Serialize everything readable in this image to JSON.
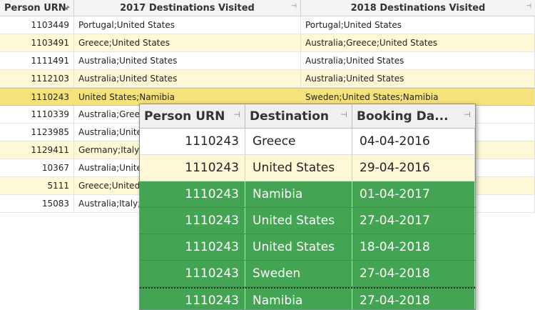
{
  "main_grid": {
    "columns": [
      "Person URN",
      "2017 Destinations Visited",
      "2018 Destinations Visited"
    ],
    "rows": [
      {
        "urn": "1103449",
        "d2017": "Portugal;United States",
        "d2018": "Portugal;United States"
      },
      {
        "urn": "1103491",
        "d2017": "Greece;United States",
        "d2018": "Australia;Greece;United States"
      },
      {
        "urn": "1111491",
        "d2017": "Australia;United States",
        "d2018": "Australia;United States"
      },
      {
        "urn": "1112103",
        "d2017": "Australia;United States",
        "d2018": "Australia;United States"
      },
      {
        "urn": "1110243",
        "d2017": "United States;Namibia",
        "d2018": "Sweden;United States;Namibia"
      },
      {
        "urn": "1110339",
        "d2017": "Australia;Greece",
        "d2018": ""
      },
      {
        "urn": "1123985",
        "d2017": "Australia;United",
        "d2018": ""
      },
      {
        "urn": "1129411",
        "d2017": "Germany;Italy",
        "d2018": ""
      },
      {
        "urn": "10367",
        "d2017": "Australia;United",
        "d2018": ""
      },
      {
        "urn": "5111",
        "d2017": "Greece;United",
        "d2018": ""
      },
      {
        "urn": "15083",
        "d2017": "Australia;Italy;P",
        "d2018": ""
      }
    ],
    "selected_row_index": 4
  },
  "detail_grid": {
    "columns": [
      "Person URN",
      "Destination",
      "Booking Da..."
    ],
    "rows": [
      {
        "urn": "1110243",
        "destination": "Greece",
        "date": "04-04-2016"
      },
      {
        "urn": "1110243",
        "destination": "United States",
        "date": "29-04-2016"
      },
      {
        "urn": "1110243",
        "destination": "Namibia",
        "date": "01-04-2017"
      },
      {
        "urn": "1110243",
        "destination": "United States",
        "date": "27-04-2017"
      },
      {
        "urn": "1110243",
        "destination": "United States",
        "date": "18-04-2018"
      },
      {
        "urn": "1110243",
        "destination": "Sweden",
        "date": "27-04-2018"
      },
      {
        "urn": "1110243",
        "destination": "Namibia",
        "date": "27-04-2018"
      }
    ]
  },
  "colors": {
    "alt_row": "#fff8d6",
    "selected_row": "#f6e27a",
    "highlight_green": "#43a553"
  },
  "icons": {
    "column_pin": "pin-icon"
  }
}
